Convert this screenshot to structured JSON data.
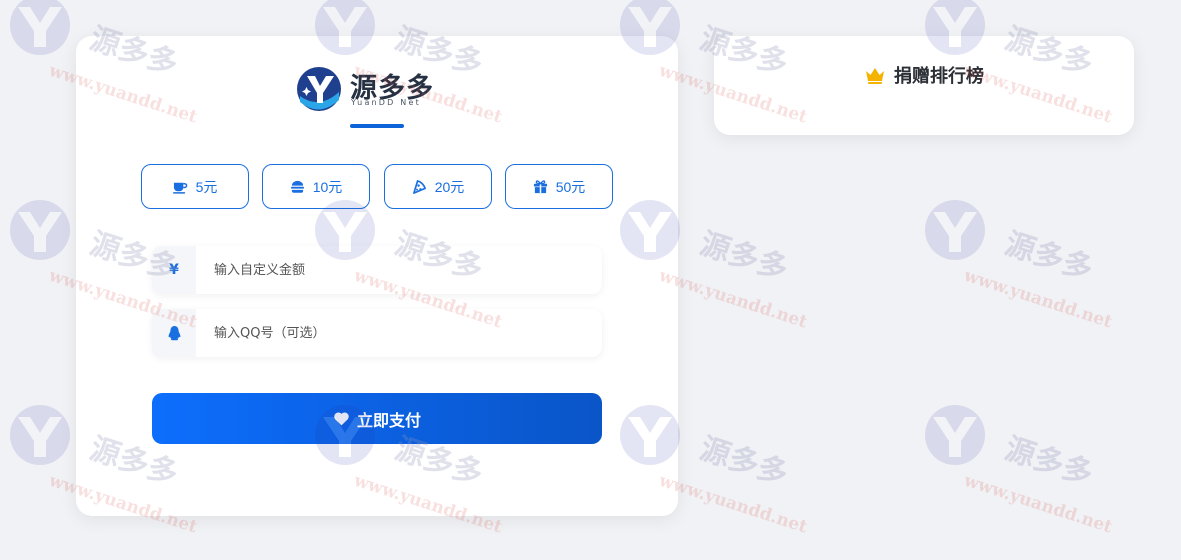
{
  "logo": {
    "brand_text": "源多多",
    "subtitle": "YuanDD Net"
  },
  "amounts": [
    {
      "label": "5元",
      "icon": "coffee-icon"
    },
    {
      "label": "10元",
      "icon": "burger-icon"
    },
    {
      "label": "20元",
      "icon": "pizza-icon"
    },
    {
      "label": "50元",
      "icon": "gift-icon"
    }
  ],
  "form": {
    "amount_symbol": "¥",
    "amount_placeholder": "输入自定义金额",
    "qq_icon": "qq-icon",
    "qq_placeholder": "输入QQ号（可选）",
    "pay_label": "立即支付",
    "pay_icon": "heart-icon"
  },
  "ranking": {
    "title": "捐赠排行榜",
    "icon": "crown-icon"
  },
  "watermark": {
    "brand": "源多多",
    "url": "www.yuandd.net"
  },
  "colors": {
    "accent": "#1a6fe0",
    "pay_gradient_start": "#0d6efd",
    "pay_gradient_end": "#0a55c8",
    "crown": "#f5b301",
    "background": "#f1f2f5"
  }
}
